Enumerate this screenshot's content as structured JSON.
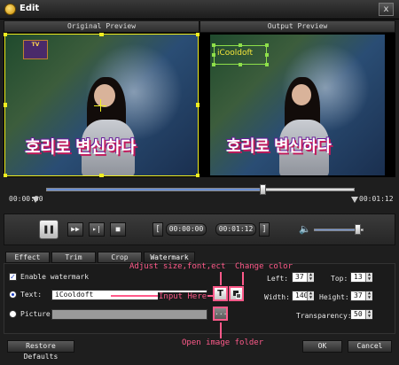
{
  "window": {
    "title": "Edit",
    "close_label": "x"
  },
  "preview": {
    "original_header": "Original Preview",
    "output_header": "Output Preview",
    "video_caption": "호리로 변신하다",
    "watermark_overlay_text": "iCooldoft"
  },
  "timeline": {
    "start_time": "00:00:50",
    "end_time": "00:01:12",
    "position_fraction": 0.7
  },
  "controls": {
    "start_box": "00:00:00",
    "end_box": "00:01:12",
    "bracket_left": "[",
    "bracket_right": "]",
    "volume_fraction": 0.88
  },
  "tabs": [
    {
      "label": "Effect",
      "active": false
    },
    {
      "label": "Trim",
      "active": false
    },
    {
      "label": "Crop",
      "active": false
    },
    {
      "label": "Watermark",
      "active": true
    }
  ],
  "watermark": {
    "enable_label": "Enable watermark",
    "enable_checked": true,
    "text_label": "Text:",
    "text_value": "iCooldoft",
    "picture_label": "Picture:",
    "picture_value": "",
    "text_button_glyph": "T",
    "left_label": "Left:",
    "left_value": "37",
    "top_label": "Top:",
    "top_value": "13",
    "width_label": "Width:",
    "width_value": "140",
    "height_label": "Height:",
    "height_value": "37",
    "transparency_label": "Transparency:",
    "transparency_value": "50"
  },
  "annotations": {
    "adjust": "Adjust size,font,ect",
    "change_color": "Change color",
    "input_here": "Input Here",
    "open_folder": "Open image folder"
  },
  "footer": {
    "restore_label": "Restore Defaults",
    "ok_label": "OK",
    "cancel_label": "Cancel"
  },
  "colors": {
    "selection": "#f0ee20",
    "annotation": "#ff5a8a",
    "watermark_text": "#f5e63a"
  }
}
